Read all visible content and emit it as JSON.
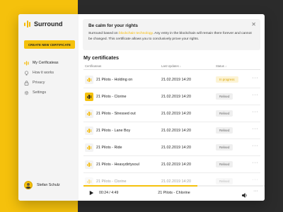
{
  "app": {
    "name": "Surround"
  },
  "sidebar": {
    "create_button": "CREATE NEW CERTIFICATE",
    "items": [
      {
        "label": "My Cerificateas",
        "icon": "bars-icon",
        "active": true
      },
      {
        "label": "How it works",
        "icon": "lightbulb-icon",
        "active": false
      },
      {
        "label": "Privacy",
        "icon": "lock-icon",
        "active": false
      },
      {
        "label": "Settings",
        "icon": "gear-icon",
        "active": false
      }
    ],
    "user_name": "Stefan Schulz"
  },
  "banner": {
    "title": "Be calm for your rights",
    "text_before": "Surround based on ",
    "link": "blockchain technology",
    "text_after": ". Any entry in the blockchain will remain there forever and cannot be changed. This certificate allows you to conclusively prove your rights.",
    "close_icon": "close-icon"
  },
  "certificates": {
    "title": "My certificates",
    "columns": [
      "Certificateas",
      "Last Updates",
      "Status"
    ],
    "rows": [
      {
        "name": "21 Pilots - Holding on",
        "date": "21.02.2019 14:20",
        "status": "In progress",
        "status_type": "progress",
        "playing": false
      },
      {
        "name": "21 Pilots - Clorine",
        "date": "21.02.2019 14:20",
        "status": "Relised",
        "status_type": "done",
        "playing": true
      },
      {
        "name": "21 Pilots - Stressed out",
        "date": "21.02.2019 14:20",
        "status": "Relised",
        "status_type": "done",
        "playing": false
      },
      {
        "name": "21 Pilots - Lane Boy",
        "date": "21.02.2019 14:20",
        "status": "Relised",
        "status_type": "done",
        "playing": false
      },
      {
        "name": "21 Pilots - Ride",
        "date": "21.02.2019 14:20",
        "status": "Relised",
        "status_type": "done",
        "playing": false
      },
      {
        "name": "21 Pilots - Heavydirtysoul",
        "date": "21.02.2019 14:20",
        "status": "Relised",
        "status_type": "done",
        "playing": false
      },
      {
        "name": "21 Pilots - Clorine",
        "date": "21.02.2019 14:20",
        "status": "Relised",
        "status_type": "done",
        "playing": false,
        "faded": true
      }
    ]
  },
  "player": {
    "time": "00:24 / 4:49",
    "track": "21 Pilots - Chlorine",
    "progress": 0.63
  },
  "colors": {
    "accent": "#F5C10C",
    "dark_bg": "#2b2b2b",
    "progress_badge_bg": "#FCF3D4",
    "progress_badge_text": "#D9A300"
  }
}
